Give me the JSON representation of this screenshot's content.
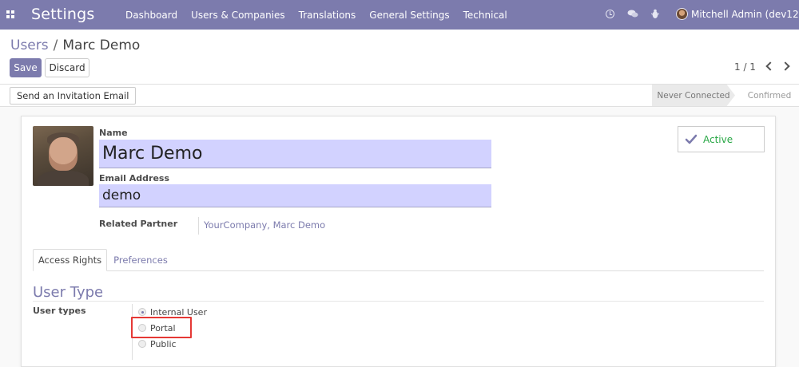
{
  "navbar": {
    "brand": "Settings",
    "menu": [
      "Dashboard",
      "Users & Companies",
      "Translations",
      "General Settings",
      "Technical"
    ],
    "user_name": "Mitchell Admin (dev12)",
    "bg_color": "#7c7bad"
  },
  "control_panel": {
    "breadcrumb_parent": "Users",
    "breadcrumb_separator": "/",
    "breadcrumb_current": "Marc Demo",
    "save_label": "Save",
    "discard_label": "Discard",
    "pager": "1 / 1"
  },
  "statusbar": {
    "invite_label": "Send an Invitation Email",
    "stages": [
      "Never Connected",
      "Confirmed"
    ],
    "current_stage": "Never Connected"
  },
  "form": {
    "name_label": "Name",
    "name_value": "Marc Demo",
    "email_label": "Email Address",
    "email_value": "demo",
    "partner_label": "Related Partner",
    "partner_value": "YourCompany, Marc Demo",
    "active_label": "Active",
    "active_color": "#28a745"
  },
  "tabs": {
    "items": [
      "Access Rights",
      "Preferences"
    ],
    "active": "Access Rights"
  },
  "access_rights": {
    "section_title": "User Type",
    "user_types_label": "User types",
    "options": [
      "Internal User",
      "Portal",
      "Public"
    ],
    "selected": "Internal User",
    "highlighted": "Portal",
    "highlight_color": "#e53935"
  }
}
